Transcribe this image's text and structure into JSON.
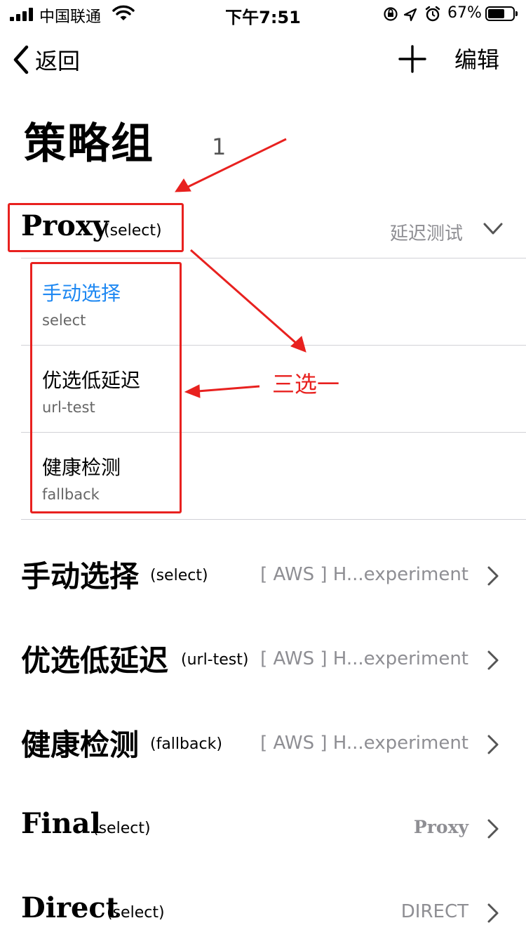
{
  "status_bar": {
    "carrier": "中国联通",
    "time": "下午7:51",
    "battery_percent": "67%",
    "battery_level": 0.67,
    "icons": [
      "signal-icon",
      "wifi-icon",
      "orientation-lock-icon",
      "location-icon",
      "alarm-icon",
      "battery-icon"
    ]
  },
  "nav": {
    "back_label": "返回",
    "add_icon": "plus-icon",
    "edit_label": "编辑"
  },
  "page_title": "策略组",
  "annotations": {
    "number": "1",
    "choose_one": "三选一",
    "color": "#e8211f"
  },
  "proxy_group": {
    "name": "Proxy",
    "type": "(select)",
    "latency_test": "延迟测试",
    "expanded": true,
    "options": [
      {
        "label": "手动选择",
        "sub": "select",
        "selected": true
      },
      {
        "label": "优选低延迟",
        "sub": "url-test",
        "selected": false
      },
      {
        "label": "健康检测",
        "sub": "fallback",
        "selected": false
      }
    ]
  },
  "groups": [
    {
      "name": "手动选择",
      "type": "(select)",
      "value": "[ AWS ] H...experiment"
    },
    {
      "name": "优选低延迟",
      "type": "(url-test)",
      "value": "[ AWS ] H...experiment"
    },
    {
      "name": "健康检测",
      "type": "(fallback)",
      "value": "[ AWS ] H...experiment"
    },
    {
      "name": "Final",
      "type": "(select)",
      "value": "Proxy"
    },
    {
      "name": "Direct",
      "type": "(select)",
      "value": "DIRECT"
    }
  ],
  "colors": {
    "accent": "#1e88f2",
    "secondary_text": "#8e8e93",
    "divider": "#d1d1d6"
  }
}
